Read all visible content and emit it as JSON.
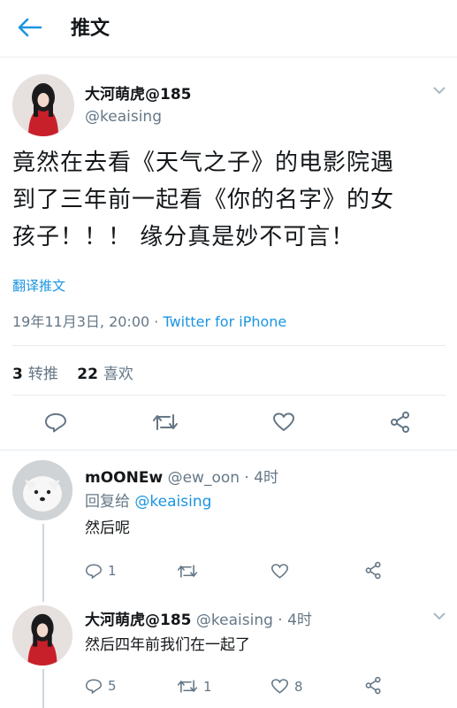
{
  "header": {
    "title": "推文"
  },
  "tweet": {
    "name": "大河萌虎@185",
    "handle": "@keaising",
    "text_lines": [
      "竟然在去看《天气之子》的电影院遇",
      "到了三年前一起看《你的名字》的女",
      "孩子！！！ 缘分真是妙不可言！"
    ],
    "translate": "翻译推文",
    "date": "19年11月3日, 20:00 · ",
    "source": "Twitter for iPhone",
    "retweets_count": "3",
    "retweets_label": "转推",
    "likes_count": "22",
    "likes_label": "喜欢"
  },
  "replies": [
    {
      "name": "mOONEw",
      "handle": "@ew_oon",
      "time": " · 4时",
      "reply_to_label": "回复给",
      "reply_to_handle": "@keaising",
      "text": "然后呢",
      "reply_count": "1",
      "retweet_count": "",
      "like_count": ""
    },
    {
      "name": "大河萌虎@185",
      "handle": "@keaising",
      "time": " · 4时",
      "text": "然后四年前我们在一起了",
      "reply_count": "5",
      "retweet_count": "1",
      "like_count": "8"
    }
  ],
  "icons": [
    "back-arrow-icon",
    "chevron-down-icon",
    "reply-icon",
    "retweet-icon",
    "like-icon",
    "share-icon"
  ],
  "colors": {
    "accent": "#1b95e0",
    "muted": "#657786",
    "border": "#e6ecf0"
  }
}
